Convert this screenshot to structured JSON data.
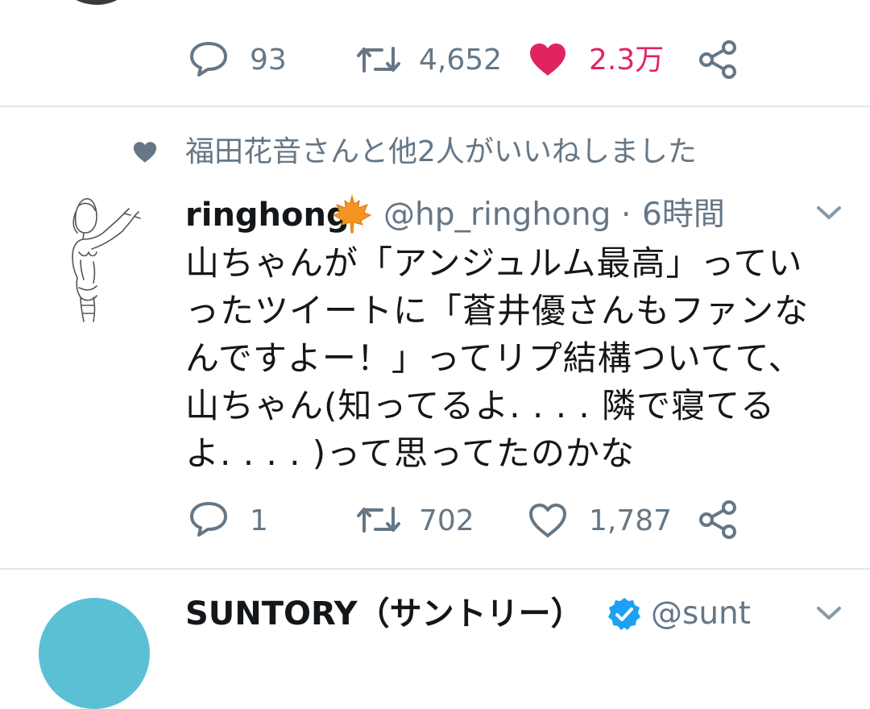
{
  "prev_tweet": {
    "reply_count": "93",
    "retweet_count": "4,652",
    "like_count": "2.3万"
  },
  "tweet": {
    "social_context": "福田花音さんと他2人がいいねしました",
    "display_name": "ringhong",
    "name_emoji": "🍁",
    "handle": "@hp_ringhong",
    "separator": "·",
    "time": "6時間",
    "lines": [
      "山ちゃんが「アンジュルム最高」ってい",
      "ったツイートに「蒼井優さんもファンな",
      "んですよー！」ってリプ結構ついてて、",
      "山ちゃん(知ってるよ. . . . 隣で寝てる",
      "よ. . . . )って思ってたのかな"
    ],
    "reply_count": "1",
    "retweet_count": "702",
    "like_count": "1,787"
  },
  "next_tweet": {
    "display_name": "SUNTORY（サントリー）",
    "handle": "@sunt"
  },
  "colors": {
    "muted": "#657786",
    "like_red": "#e0245e",
    "verified_blue": "#1da1f2",
    "divider": "#e1e8ed",
    "avatar_teal": "#5bc0d6"
  },
  "icons": [
    "reply-icon",
    "retweet-icon",
    "heart-icon",
    "share-icon",
    "chevron-down-icon",
    "verified-badge-icon",
    "maple-leaf-icon"
  ]
}
